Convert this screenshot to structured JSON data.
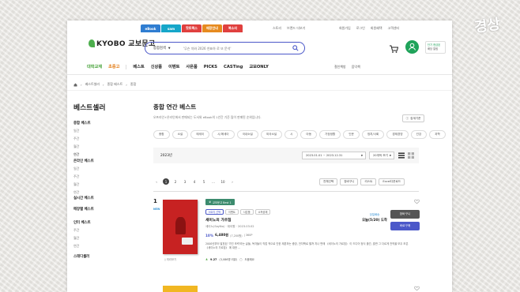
{
  "svc_tabs": [
    {
      "label": "eBook",
      "color": "#2f7dd1"
    },
    {
      "label": "sam",
      "color": "#15a6c9"
    },
    {
      "label": "핫트랙스",
      "color": "#e0403e"
    },
    {
      "label": "매장안내",
      "color": "#e68a1f"
    },
    {
      "label": "북소리",
      "color": "#e0403e"
    }
  ],
  "top_links_left": [
    "스토리",
    "브랜드 더보기"
  ],
  "top_links_right": [
    "회원가입",
    "로그인",
    "회원혜택",
    "고객센터"
  ],
  "logo": {
    "text": "KYOBO 교보문고"
  },
  "search": {
    "category": "통합검색",
    "placeholder": "'무슨 차와 2026 연표하 로 또 문석'"
  },
  "promo": {
    "line1": "단기 현금된",
    "line2": "배당 알림"
  },
  "nav": {
    "items": [
      {
        "label": "대학교재",
        "style": "green"
      },
      {
        "label": "초중고",
        "style": "orange"
      },
      {
        "label": "베스트"
      },
      {
        "label": "신상품"
      },
      {
        "label": "이벤트"
      },
      {
        "label": "사은품"
      },
      {
        "label": "PICKS"
      },
      {
        "label": "CASTing"
      },
      {
        "label": "교보ONLY"
      }
    ],
    "right": [
      "철인책방",
      "음악책"
    ]
  },
  "breadcrumb": [
    "베스트셀러",
    "종합 베스트",
    "종합"
  ],
  "sidebar": {
    "title": "베스트셀러",
    "groups": [
      {
        "head": "종합 베스트",
        "items": [
          "일간",
          "주간",
          "월간",
          "연간"
        ],
        "active": 3
      },
      {
        "head": "온라인 베스트",
        "items": [
          "일간",
          "주간",
          "월간",
          "연간"
        ],
        "active": -1
      },
      {
        "head": "실시간 베스트",
        "items": [],
        "active": -1
      },
      {
        "head": "매장별 베스트",
        "items": [],
        "active": -1
      },
      {
        "head": "인터 베스트",
        "items": [
          "주간",
          "월간",
          "연간"
        ],
        "active": -1
      },
      {
        "head": "스테디셀러",
        "items": [],
        "active": -1
      }
    ]
  },
  "main": {
    "title": "종합 연간 베스트",
    "desc": "오프라인+온라인에서 판매되는 도서와 eBook의 1년간 기준 많이 판매된 순위입니다.",
    "view_all": "집계기준",
    "genres": [
      "종합",
      "소설",
      "에세이",
      "시/에세이",
      "국내소설",
      "외국소설",
      "시",
      "아동",
      "가정생활",
      "인문",
      "정치/사회",
      "경제경영",
      "건강",
      "과학"
    ],
    "year": "2023년",
    "date_range": "2023.01.01 ~ 2023.12.31",
    "page_size": "20개씩 보기",
    "pages": [
      "1",
      "2",
      "3",
      "4",
      "5",
      "...",
      "10"
    ],
    "active_page": 0,
    "list_actions": [
      "전체선택",
      "장바구니",
      "리스트",
      "Excel다운로드"
    ]
  },
  "book": {
    "rank": "1",
    "rank_badge": "NEW",
    "badge": "교보문고 Best 1",
    "tags": [
      "MD의 선택",
      "이벤트",
      "사은품",
      "소득공제"
    ],
    "title": "세이노의 가르침",
    "meta": "세이노(SayNo) · 데이원 · 2023.03.02",
    "discount": "10%",
    "price": "6,480원",
    "original_price": "(7,200원)",
    "point": "| 360P",
    "desc": "2000년부터 발표된 '가진 조력'라는 글들, 독자들이 직접 적으로 인한 제본하는 중앙, 전자책로 펼쳐 지나 판매 《세이노의 가르침》 이 드디어 정식 출간, 출판 그 다르게 전작을 모두 모은 《세이노의 가르침》 에 대한 ...",
    "preview": "미리보기",
    "review_score": "9.27",
    "review_count": "(3,086명 리뷰)",
    "review_tag": "도움돼요",
    "delivery_top": "당일배송",
    "delivery_bottom": "오늘(5/20) 도착",
    "cart_btn": "장바구니",
    "buy_btn": "바로구매"
  },
  "colors": {
    "accent": "#4b58c9",
    "green": "#4aa43d",
    "cover": "#c72222"
  }
}
